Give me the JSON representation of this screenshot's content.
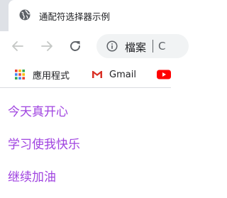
{
  "tab": {
    "title": "通配符选择器示例",
    "favicon": "globe-icon"
  },
  "toolbar": {
    "back_icon": "back-arrow-icon",
    "forward_icon": "forward-arrow-icon",
    "reload_icon": "reload-icon",
    "omnibox_info_icon": "info-icon",
    "omnibox_label": "檔案",
    "omnibox_url": "C"
  },
  "bookmarks": {
    "items": [
      {
        "label": "應用程式",
        "icon": "apps-grid-icon"
      },
      {
        "label": "Gmail",
        "icon": "gmail-icon"
      },
      {
        "label": "",
        "icon": "youtube-icon"
      }
    ]
  },
  "content": {
    "lines": [
      "今天真开心",
      "学习使我快乐",
      "继续加油"
    ],
    "text_color": "#a044e0"
  }
}
